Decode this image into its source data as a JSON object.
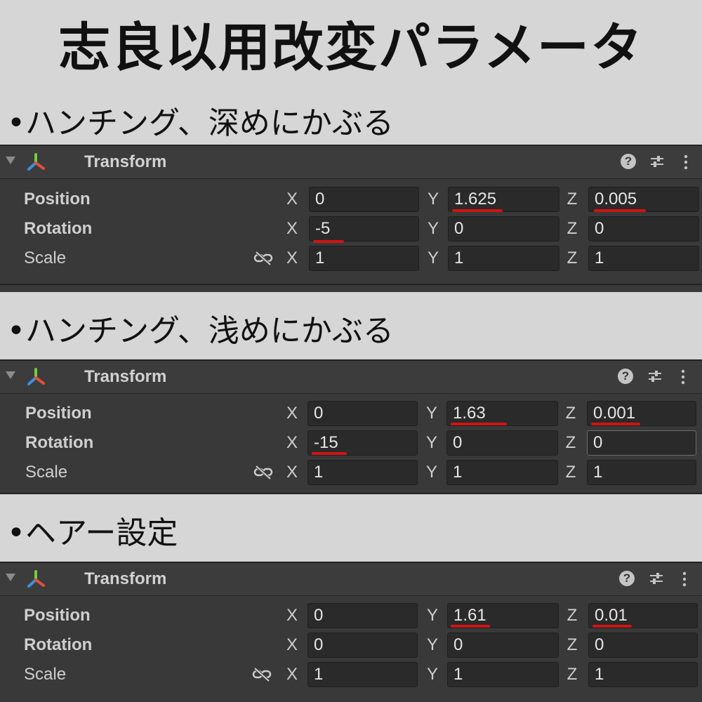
{
  "title": "志良以用改変パラメータ",
  "sections": [
    {
      "heading": "•ハンチング、深めにかぶる",
      "panel_title": "Transform",
      "position": {
        "label": "Position",
        "x": "0",
        "y": "1.625",
        "z": "0.005"
      },
      "rotation": {
        "label": "Rotation",
        "x": "-5",
        "y": "0",
        "z": "0"
      },
      "scale": {
        "label": "Scale",
        "x": "1",
        "y": "1",
        "z": "1"
      }
    },
    {
      "heading": "•ハンチング、浅めにかぶる",
      "panel_title": "Transform",
      "position": {
        "label": "Position",
        "x": "0",
        "y": "1.63",
        "z": "0.001"
      },
      "rotation": {
        "label": "Rotation",
        "x": "-15",
        "y": "0",
        "z": "0"
      },
      "scale": {
        "label": "Scale",
        "x": "1",
        "y": "1",
        "z": "1"
      }
    },
    {
      "heading": "•ヘアー設定",
      "panel_title": "Transform",
      "position": {
        "label": "Position",
        "x": "0",
        "y": "1.61",
        "z": "0.01"
      },
      "rotation": {
        "label": "Rotation",
        "x": "0",
        "y": "0",
        "z": "0"
      },
      "scale": {
        "label": "Scale",
        "x": "1",
        "y": "1",
        "z": "1"
      }
    }
  ],
  "axes": {
    "x": "X",
    "y": "Y",
    "z": "Z"
  },
  "icons": {
    "foldout": "triangle-down-icon",
    "component": "transform-axes-icon",
    "help": "help-icon",
    "presets": "sliders-icon",
    "menu": "kebab-menu-icon",
    "constrain": "unlinked-chain-icon"
  },
  "colors": {
    "background": "#d6d6d6",
    "panel": "#393939",
    "field": "#2a2a2a",
    "highlight_underline": "#d01414",
    "axis_red": "#e0513a",
    "axis_green": "#7ac943",
    "axis_blue": "#3d8fe0"
  }
}
